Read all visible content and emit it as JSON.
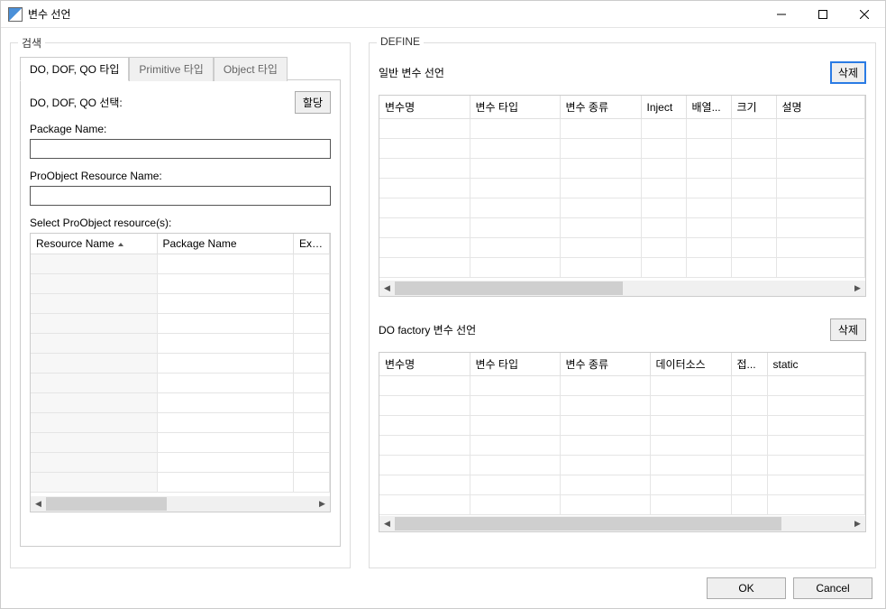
{
  "window": {
    "title": "변수 선언"
  },
  "search": {
    "group_title": "검색",
    "tabs": {
      "tab1": "DO, DOF, QO 타입",
      "tab2": "Primitive 타입",
      "tab3": "Object 타입"
    },
    "select_label": "DO, DOF, QO 선택:",
    "assign_button": "할당",
    "package_label": "Package Name:",
    "package_value": "",
    "resource_label": "ProObject Resource Name:",
    "resource_value": "",
    "table_caption": "Select ProObject resource(s):",
    "table_headers": {
      "col1": "Resource Name",
      "col2": "Package Name",
      "col3": "Exter"
    }
  },
  "define": {
    "group_title": "DEFINE",
    "section1": {
      "title": "일반 변수 선언",
      "delete_button": "삭제",
      "headers": {
        "c1": "변수명",
        "c2": "변수 타입",
        "c3": "변수 종류",
        "c4": "Inject",
        "c5": "배열...",
        "c6": "크기",
        "c7": "설명"
      }
    },
    "section2": {
      "title": "DO factory 변수 선언",
      "delete_button": "삭제",
      "headers": {
        "c1": "변수명",
        "c2": "변수 타입",
        "c3": "변수 종류",
        "c4": "데이터소스",
        "c5": "접...",
        "c6": "static"
      }
    }
  },
  "footer": {
    "ok": "OK",
    "cancel": "Cancel"
  }
}
